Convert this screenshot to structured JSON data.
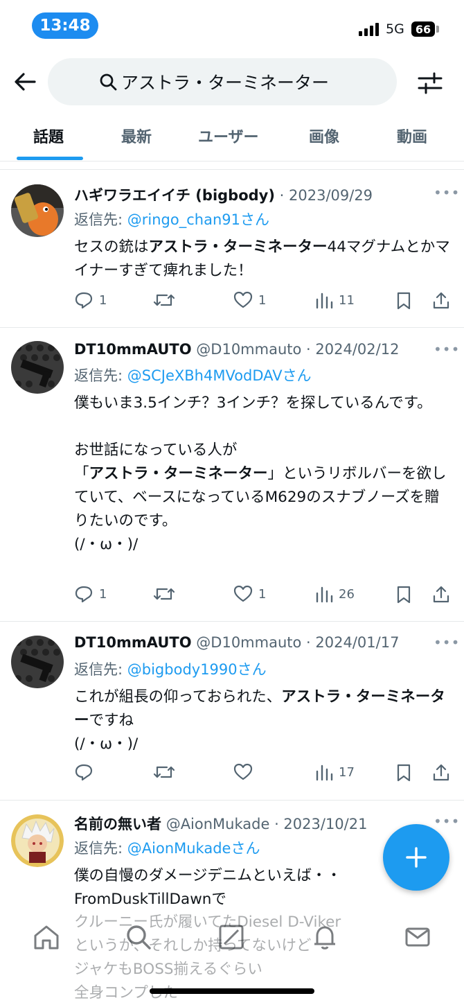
{
  "status_bar": {
    "time": "13:48",
    "network": "5G",
    "battery": "66"
  },
  "search": {
    "query": "アストラ・ターミネーター"
  },
  "tabs": [
    "話題",
    "最新",
    "ユーザー",
    "画像",
    "動画"
  ],
  "tweets": [
    {
      "name": "ハギワラエイイチ (bigbody)",
      "handle": "",
      "date": "2023/09/29",
      "reply_prefix": "返信先:",
      "reply_to": "@ringo_chan91",
      "reply_suffix": "さん",
      "body_pre": "セスの銃は",
      "body_bold": "アストラ・ターミネーター",
      "body_post": "44マグナムとかマイナーすぎて痺れました！",
      "replies": "1",
      "retweets": "",
      "likes": "1",
      "views": "11"
    },
    {
      "name": "DT10mmAUTO",
      "handle": "@D10mmauto",
      "date": "2024/02/12",
      "reply_prefix": "返信先:",
      "reply_to": "@SCJeXBh4MVodDAV",
      "reply_suffix": "さん",
      "body_line1": "僕もいま3.5インチ？3インチ？を探しているんです。",
      "body_line2": "お世話になっている人が",
      "body_pre": "「",
      "body_bold": "アストラ・ターミネーター",
      "body_post": "」というリボルバーを欲していて、ベースになっているM629のスナブノーズを贈りたいのです。",
      "body_line3": "(/・ω・)/",
      "replies": "1",
      "retweets": "",
      "likes": "1",
      "views": "26"
    },
    {
      "name": "DT10mmAUTO",
      "handle": "@D10mmauto",
      "date": "2024/01/17",
      "reply_prefix": "返信先:",
      "reply_to": "@bigbody1990",
      "reply_suffix": "さん",
      "body_pre": "これが組長の仰っておられた、",
      "body_bold": "アストラ・ターミネーター",
      "body_post": "ですね",
      "body_line3": "(/・ω・)/",
      "replies": "",
      "retweets": "",
      "likes": "",
      "views": "17"
    },
    {
      "name": "名前の無い者",
      "handle": "@AionMukade",
      "date": "2023/10/21",
      "reply_prefix": "返信先:",
      "reply_to": "@AionMukade",
      "reply_suffix": "さん",
      "body_line1": "僕の自慢のダメージデニムといえば・・",
      "body_line2": "FromDuskTillDawnで",
      "body_line3": "クルーニー氏が履いてたDiesel D-Viker",
      "body_line4": "というか、それしか持ってないけど",
      "body_line5": "ジャケもBOSS揃えるぐらい",
      "body_line6": "全身コンプした"
    }
  ]
}
